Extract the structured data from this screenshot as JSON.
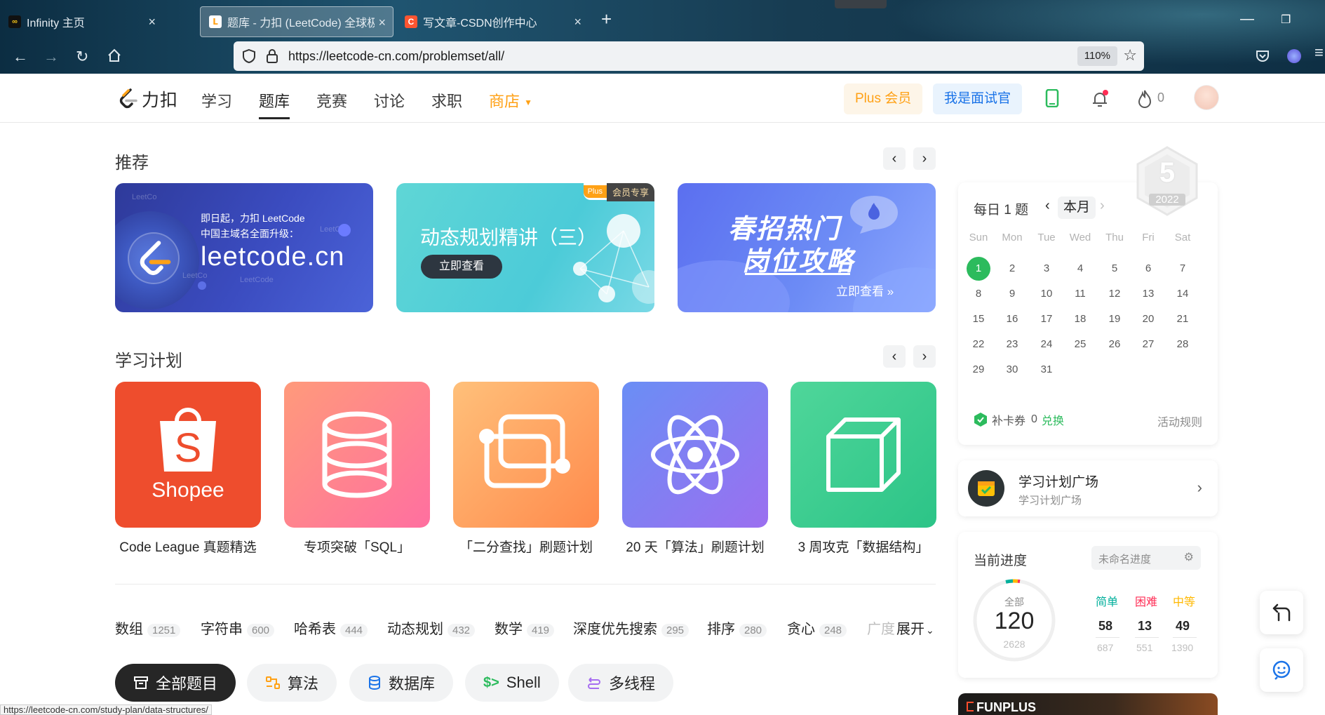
{
  "browser": {
    "tabs": [
      {
        "title": "Infinity 主页"
      },
      {
        "title": "题库 - 力扣 (LeetCode) 全球极"
      },
      {
        "title": "写文章-CSDN创作中心"
      }
    ],
    "url": "https://leetcode-cn.com/problemset/all/",
    "zoom": "110%",
    "status_link": "https://leetcode-cn.com/study-plan/data-structures/"
  },
  "header": {
    "logo_text": "力扣",
    "nav": [
      "学习",
      "题库",
      "竞赛",
      "讨论",
      "求职",
      "商店"
    ],
    "plus_label": "Plus 会员",
    "interviewer_label": "我是面试官",
    "fire_count": "0"
  },
  "recommend": {
    "title": "推荐",
    "banners": [
      {
        "line1": "即日起，力扣 LeetCode",
        "line2": "中国主域名全面升级：",
        "domain": "leetcode.cn",
        "wm1": "LeetCo",
        "wm2": "LeetC",
        "wm3": "LeetCo",
        "wm4": "LeetCode"
      },
      {
        "badge": "Plus",
        "badge_text": "会员专享",
        "title": "动态规划精讲（三）",
        "button": "立即查看"
      },
      {
        "title1": "春招热门",
        "title2": "岗位攻略",
        "link": "立即查看 »"
      }
    ]
  },
  "study_plan": {
    "title": "学习计划",
    "plans": [
      {
        "name": "Code League 真题精选",
        "brand": "Shopee"
      },
      {
        "name": "专项突破「SQL」"
      },
      {
        "name": "「二分查找」刷题计划"
      },
      {
        "name": "20 天「算法」刷题计划"
      },
      {
        "name": "3 周攻克「数据结构」"
      }
    ]
  },
  "tags": [
    {
      "name": "数组",
      "count": "1251"
    },
    {
      "name": "字符串",
      "count": "600"
    },
    {
      "name": "哈希表",
      "count": "444"
    },
    {
      "name": "动态规划",
      "count": "432"
    },
    {
      "name": "数学",
      "count": "419"
    },
    {
      "name": "深度优先搜索",
      "count": "295"
    },
    {
      "name": "排序",
      "count": "280"
    },
    {
      "name": "贪心",
      "count": "248"
    },
    {
      "name": "广度",
      "count": ""
    }
  ],
  "expand_label": "展开",
  "pills": [
    "全部题目",
    "算法",
    "数据库",
    "Shell",
    "多线程"
  ],
  "calendar": {
    "title": "每日 1 题",
    "month_label": "本月",
    "weekdays": [
      "Sun",
      "Mon",
      "Tue",
      "Wed",
      "Thu",
      "Fri",
      "Sat"
    ],
    "days": [
      "1",
      "2",
      "3",
      "4",
      "5",
      "6",
      "7",
      "8",
      "9",
      "10",
      "11",
      "12",
      "13",
      "14",
      "15",
      "16",
      "17",
      "18",
      "19",
      "20",
      "21",
      "22",
      "23",
      "24",
      "25",
      "26",
      "27",
      "28",
      "29",
      "30",
      "31"
    ],
    "today": "1",
    "badge_number": "5",
    "badge_year": "2022",
    "coupon_label": "补卡券",
    "coupon_count": "0",
    "redeem_label": "兑换",
    "rules_label": "活动规则"
  },
  "plaza": {
    "title": "学习计划广场",
    "subtitle": "学习计划广场"
  },
  "progress": {
    "title": "当前进度",
    "select_placeholder": "未命名进度",
    "total_label": "全部",
    "solved": "120",
    "total": "2628",
    "levels": [
      {
        "label": "简单",
        "solved": "58",
        "total": "687",
        "color": "#00af9b"
      },
      {
        "label": "困难",
        "solved": "13",
        "total": "551",
        "color": "#ff2d55"
      },
      {
        "label": "中等",
        "solved": "49",
        "total": "1390",
        "color": "#ffb800"
      }
    ]
  },
  "ad": {
    "text": "FUNPLUS"
  },
  "colors": {
    "brand_orange": "#ffa116",
    "blue": "#1a73e8",
    "green": "#2cbb5d"
  }
}
